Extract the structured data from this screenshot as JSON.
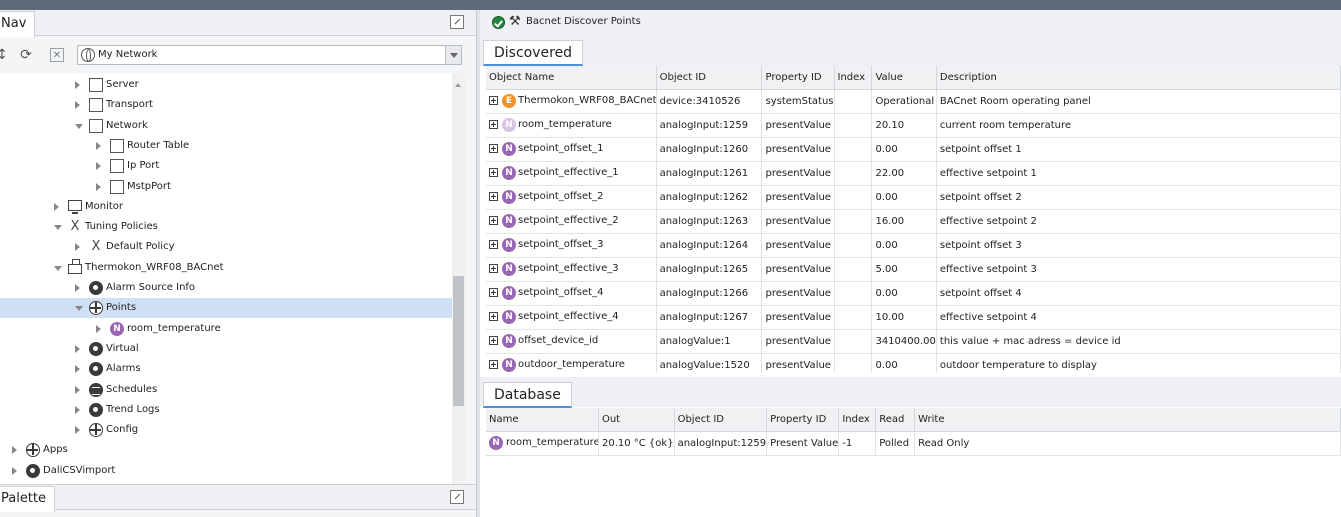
{
  "nav": {
    "title": "Nav",
    "combo_value": "My Network",
    "tree": [
      {
        "label": "Server",
        "icon": "folder",
        "depth": 5,
        "twisty": "closed"
      },
      {
        "label": "Transport",
        "icon": "folder",
        "depth": 5,
        "twisty": "closed"
      },
      {
        "label": "Network",
        "icon": "folder",
        "depth": 5,
        "twisty": "open"
      },
      {
        "label": "Router Table",
        "icon": "folder",
        "depth": 6,
        "twisty": "closed"
      },
      {
        "label": "Ip Port",
        "icon": "folder",
        "depth": 6,
        "twisty": "closed"
      },
      {
        "label": "MstpPort",
        "icon": "folder",
        "depth": 6,
        "twisty": "closed"
      },
      {
        "label": "Monitor",
        "icon": "monitor",
        "depth": 4,
        "twisty": "closed"
      },
      {
        "label": "Tuning Policies",
        "icon": "tool",
        "depth": 4,
        "twisty": "open"
      },
      {
        "label": "Default Policy",
        "icon": "tool",
        "depth": 5,
        "twisty": "closed"
      },
      {
        "label": "Thermokon_WRF08_BACnet",
        "icon": "device",
        "depth": 4,
        "twisty": "open"
      },
      {
        "label": "Alarm Source Info",
        "icon": "round",
        "depth": 5,
        "twisty": "closed"
      },
      {
        "label": "Points",
        "icon": "grid",
        "depth": 5,
        "twisty": "open",
        "selected": true
      },
      {
        "label": "room_temperature",
        "icon": "n",
        "depth": 6,
        "twisty": "closed"
      },
      {
        "label": "Virtual",
        "icon": "round",
        "depth": 5,
        "twisty": "closed"
      },
      {
        "label": "Alarms",
        "icon": "round",
        "depth": 5,
        "twisty": "closed"
      },
      {
        "label": "Schedules",
        "icon": "sched",
        "depth": 5,
        "twisty": "closed"
      },
      {
        "label": "Trend Logs",
        "icon": "round",
        "depth": 5,
        "twisty": "closed"
      },
      {
        "label": "Config",
        "icon": "grid",
        "depth": 5,
        "twisty": "closed"
      },
      {
        "label": "Apps",
        "icon": "grid",
        "depth": 2,
        "twisty": "closed"
      },
      {
        "label": "DaliCSVimport",
        "icon": "round",
        "depth": 2,
        "twisty": "closed"
      }
    ]
  },
  "palette": {
    "title": "Palette"
  },
  "view": {
    "title": "Bacnet Discover Points"
  },
  "discovered": {
    "tab_label": "Discovered",
    "columns": [
      "Object Name",
      "Object ID",
      "Property ID",
      "Index",
      "Value",
      "Description"
    ],
    "rows": [
      {
        "icon": "E",
        "name": "Thermokon_WRF08_BACnet",
        "object_id": "device:3410526",
        "property_id": "systemStatus",
        "index": "",
        "value": "Operational",
        "description": "BACnet Room operating panel"
      },
      {
        "icon": "N-faded",
        "name": "room_temperature",
        "object_id": "analogInput:1259",
        "property_id": "presentValue",
        "index": "",
        "value": "20.10",
        "description": "current room temperature"
      },
      {
        "icon": "N",
        "name": "setpoint_offset_1",
        "object_id": "analogInput:1260",
        "property_id": "presentValue",
        "index": "",
        "value": "0.00",
        "description": "setpoint offset 1"
      },
      {
        "icon": "N",
        "name": "setpoint_effective_1",
        "object_id": "analogInput:1261",
        "property_id": "presentValue",
        "index": "",
        "value": "22.00",
        "description": "effective setpoint 1"
      },
      {
        "icon": "N",
        "name": "setpoint_offset_2",
        "object_id": "analogInput:1262",
        "property_id": "presentValue",
        "index": "",
        "value": "0.00",
        "description": "setpoint offset 2"
      },
      {
        "icon": "N",
        "name": "setpoint_effective_2",
        "object_id": "analogInput:1263",
        "property_id": "presentValue",
        "index": "",
        "value": "16.00",
        "description": "effective setpoint 2"
      },
      {
        "icon": "N",
        "name": "setpoint_offset_3",
        "object_id": "analogInput:1264",
        "property_id": "presentValue",
        "index": "",
        "value": "0.00",
        "description": "setpoint offset 3"
      },
      {
        "icon": "N",
        "name": "setpoint_effective_3",
        "object_id": "analogInput:1265",
        "property_id": "presentValue",
        "index": "",
        "value": "5.00",
        "description": "effective setpoint 3"
      },
      {
        "icon": "N",
        "name": "setpoint_offset_4",
        "object_id": "analogInput:1266",
        "property_id": "presentValue",
        "index": "",
        "value": "0.00",
        "description": "setpoint offset 4"
      },
      {
        "icon": "N",
        "name": "setpoint_effective_4",
        "object_id": "analogInput:1267",
        "property_id": "presentValue",
        "index": "",
        "value": "10.00",
        "description": "effective setpoint 4"
      },
      {
        "icon": "N",
        "name": "offset_device_id",
        "object_id": "analogValue:1",
        "property_id": "presentValue",
        "index": "",
        "value": "3410400.00",
        "description": "this value + mac adress = device id"
      },
      {
        "icon": "N",
        "name": "outdoor_temperature",
        "object_id": "analogValue:1520",
        "property_id": "presentValue",
        "index": "",
        "value": "0.00",
        "description": "outdoor temperature to display"
      }
    ]
  },
  "database": {
    "tab_label": "Database",
    "columns": [
      "Name",
      "Out",
      "Object ID",
      "Property ID",
      "Index",
      "Read",
      "Write"
    ],
    "rows": [
      {
        "icon": "N",
        "name": "room_temperature",
        "out": "20.10 °C {ok}",
        "object_id": "analogInput:1259",
        "property_id": "Present Value",
        "index": "-1",
        "read": "Polled",
        "write": "Read Only"
      }
    ]
  },
  "colors": {
    "selection": "#cfe0f5",
    "numeric_point": "#9b67b5",
    "enum_point": "#f0932b",
    "ok_green": "#1f8a3a",
    "tab_underline": "#4f8fd6"
  }
}
